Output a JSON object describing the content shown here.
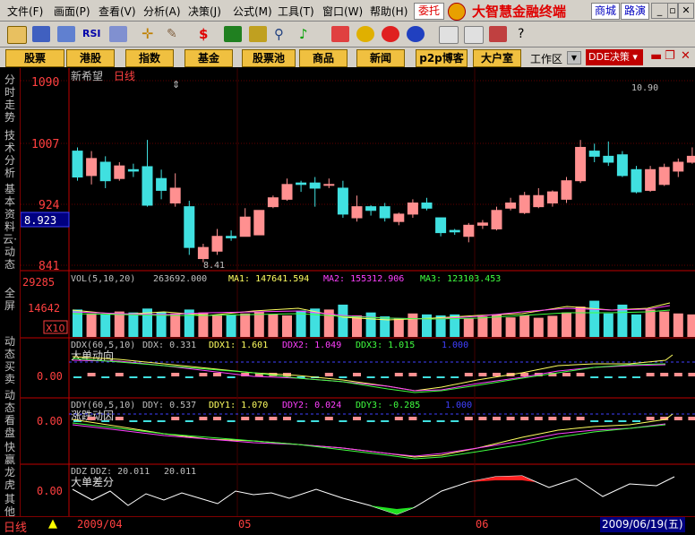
{
  "menu": [
    "文件(F)",
    "画面(P)",
    "查看(V)",
    "分析(A)",
    "决策(J)",
    "公式(M)",
    "工具(T)",
    "窗口(W)",
    "帮助(H)"
  ],
  "entrust_label": "委托",
  "brand_title": "大智慧金融终端",
  "shop_label": "商城",
  "roadshow_label": "路演",
  "categories": [
    "股票",
    "港股",
    "指数",
    "基金",
    "股票池",
    "商品",
    "新闻",
    "p2p博客",
    "大户室"
  ],
  "workspace_label": "工作区",
  "dde_label": "DDE决策",
  "sidebar_tabs": [
    "分时走势",
    "技术分析",
    "基本资料",
    "云·动态",
    "全屏",
    "动态买卖",
    "动态看盘",
    "快赢龙虎",
    "其他"
  ],
  "stock_name": "新希望",
  "period": "日线",
  "price_axis": [
    "1090",
    "1007",
    "924",
    "841"
  ],
  "current_price": "8.923",
  "high_label": "10.90",
  "low_label": "8.41",
  "vol_axis": [
    "29285",
    "14642",
    "X10"
  ],
  "vol_header": {
    "name": "VOL(5,10,20)",
    "v": "263692.000",
    "ma1": "MA1: 147641.594",
    "ma2": "MA2: 155312.906",
    "ma3": "MA3: 123103.453"
  },
  "ddx_header": {
    "name": "DDX(60,5,10)",
    "v": "DDX: 0.331",
    "d1": "DDX1: 1.601",
    "d2": "DDX2: 1.049",
    "d3": "DDX3: 1.015",
    "ref": "1.000",
    "title": "大单动向",
    "axis": "0.00"
  },
  "ddy_header": {
    "name": "DDY(60,5,10)",
    "v": "DDY: 0.537",
    "d1": "DDY1: 1.070",
    "d2": "DDY2: 0.024",
    "d3": "DDY3: -0.285",
    "ref": "1.000",
    "title": "涨跌动因",
    "axis": "0.00"
  },
  "ddz_header": {
    "name": "DDZ",
    "v": "DDZ: 20.011",
    "d1": "20.011",
    "title": "大单差分",
    "axis": "0.00"
  },
  "bottom": {
    "period": "日线",
    "dates": [
      "2009/04",
      "05",
      "06"
    ],
    "current_date": "2009/06/19(五)"
  },
  "colors": {
    "up": "#ff5050",
    "up_fill": "#ff9090",
    "down": "#40e0e0",
    "axis": "#c00000"
  },
  "chart_data": {
    "type": "candlestick",
    "candles": [
      {
        "o": 9.95,
        "c": 9.6,
        "h": 10.0,
        "l": 9.55
      },
      {
        "o": 9.62,
        "c": 9.85,
        "h": 9.95,
        "l": 9.5
      },
      {
        "o": 9.8,
        "c": 9.55,
        "h": 9.88,
        "l": 9.45
      },
      {
        "o": 9.58,
        "c": 9.75,
        "h": 9.8,
        "l": 9.55
      },
      {
        "o": 9.7,
        "c": 9.68,
        "h": 9.78,
        "l": 9.6
      },
      {
        "o": 9.74,
        "c": 9.22,
        "h": 10.1,
        "l": 9.2
      },
      {
        "o": 9.58,
        "c": 9.42,
        "h": 9.7,
        "l": 9.3
      },
      {
        "o": 9.25,
        "c": 9.45,
        "h": 9.65,
        "l": 9.2
      },
      {
        "o": 9.2,
        "c": 8.65,
        "h": 9.28,
        "l": 8.55
      },
      {
        "o": 8.5,
        "c": 8.65,
        "h": 8.7,
        "l": 8.45
      },
      {
        "o": 8.6,
        "c": 8.8,
        "h": 8.9,
        "l": 8.55
      },
      {
        "o": 8.8,
        "c": 8.78,
        "h": 8.88,
        "l": 8.74
      },
      {
        "o": 8.8,
        "c": 9.06,
        "h": 9.18,
        "l": 8.8
      },
      {
        "o": 8.82,
        "c": 9.15,
        "h": 9.15,
        "l": 8.82
      },
      {
        "o": 9.2,
        "c": 9.32,
        "h": 9.35,
        "l": 9.18
      },
      {
        "o": 9.3,
        "c": 9.5,
        "h": 9.58,
        "l": 9.28
      },
      {
        "o": 9.52,
        "c": 9.5,
        "h": 9.55,
        "l": 9.4
      },
      {
        "o": 9.52,
        "c": 9.45,
        "h": 9.6,
        "l": 9.2
      },
      {
        "o": 9.5,
        "c": 9.5,
        "h": 9.58,
        "l": 9.45
      },
      {
        "o": 9.45,
        "c": 9.1,
        "h": 9.55,
        "l": 9.05
      },
      {
        "o": 9.05,
        "c": 9.2,
        "h": 9.35,
        "l": 9.0
      },
      {
        "o": 9.2,
        "c": 9.15,
        "h": 9.22,
        "l": 9.08
      },
      {
        "o": 9.2,
        "c": 9.05,
        "h": 9.25,
        "l": 9.0
      },
      {
        "o": 9.0,
        "c": 9.1,
        "h": 9.12,
        "l": 8.95
      },
      {
        "o": 9.1,
        "c": 9.25,
        "h": 9.3,
        "l": 9.05
      },
      {
        "o": 9.25,
        "c": 9.18,
        "h": 9.32,
        "l": 9.15
      },
      {
        "o": 9.05,
        "c": 8.85,
        "h": 9.05,
        "l": 8.8
      },
      {
        "o": 8.88,
        "c": 8.86,
        "h": 8.9,
        "l": 8.82
      },
      {
        "o": 8.8,
        "c": 8.95,
        "h": 8.98,
        "l": 8.72
      },
      {
        "o": 8.95,
        "c": 8.98,
        "h": 9.02,
        "l": 8.9
      },
      {
        "o": 8.9,
        "c": 9.15,
        "h": 9.2,
        "l": 8.88
      },
      {
        "o": 9.18,
        "c": 9.25,
        "h": 9.32,
        "l": 9.15
      },
      {
        "o": 9.12,
        "c": 9.35,
        "h": 9.4,
        "l": 9.1
      },
      {
        "o": 9.2,
        "c": 9.35,
        "h": 9.45,
        "l": 9.18
      },
      {
        "o": 9.25,
        "c": 9.4,
        "h": 9.42,
        "l": 9.2
      },
      {
        "o": 9.3,
        "c": 9.55,
        "h": 9.6,
        "l": 9.25
      },
      {
        "o": 9.55,
        "c": 10.0,
        "h": 10.1,
        "l": 9.52
      },
      {
        "o": 9.95,
        "c": 9.88,
        "h": 10.05,
        "l": 9.8
      },
      {
        "o": 9.88,
        "c": 9.8,
        "h": 10.08,
        "l": 9.75
      },
      {
        "o": 9.9,
        "c": 9.62,
        "h": 9.95,
        "l": 9.6
      },
      {
        "o": 9.7,
        "c": 9.4,
        "h": 9.75,
        "l": 9.38
      },
      {
        "o": 9.42,
        "c": 9.7,
        "h": 9.75,
        "l": 9.4
      },
      {
        "o": 9.5,
        "c": 9.73,
        "h": 9.78,
        "l": 9.48
      },
      {
        "o": 9.68,
        "c": 9.8,
        "h": 9.85,
        "l": 9.6
      },
      {
        "o": 9.8,
        "c": 9.88,
        "h": 10.0,
        "l": 9.78
      },
      {
        "o": 9.9,
        "c": 9.88,
        "h": 10.1,
        "l": 9.8
      },
      {
        "o": 9.95,
        "c": 10.5,
        "h": 10.9,
        "l": 9.9
      }
    ],
    "volume": [
      14000,
      12000,
      11500,
      13000,
      12500,
      14500,
      12800,
      12000,
      14000,
      12500,
      11000,
      11500,
      12000,
      13000,
      11500,
      11000,
      13500,
      14500,
      14000,
      16500,
      11000,
      12500,
      10500,
      9500,
      12000,
      11500,
      11000,
      11500,
      9500,
      10500,
      11500,
      10000,
      11000,
      9800,
      10800,
      12500,
      15500,
      18500,
      12000,
      16500,
      11500,
      14000,
      13000,
      12000,
      11500,
      13500,
      26369
    ]
  }
}
